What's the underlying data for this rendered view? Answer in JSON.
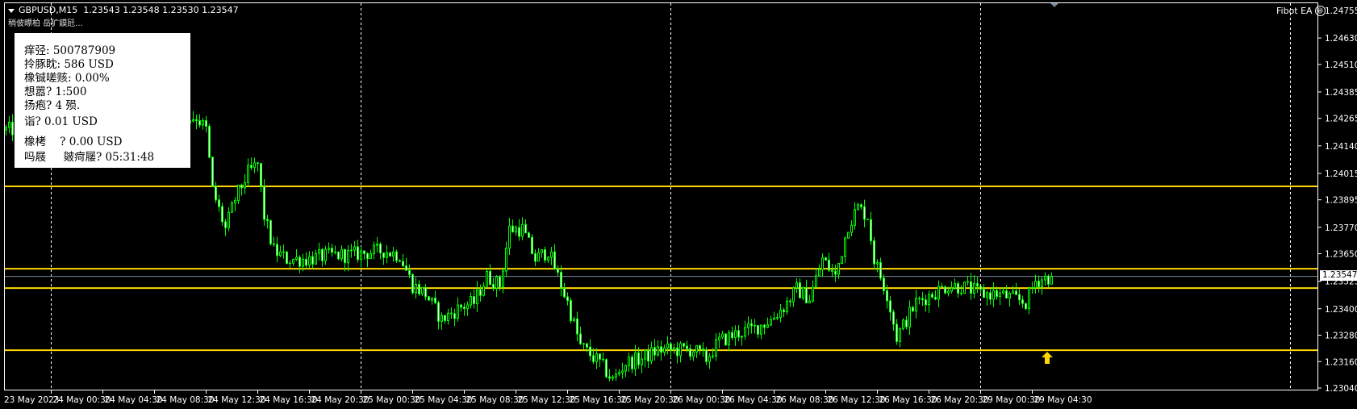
{
  "header": {
    "symbol": "GBPUSD,M15",
    "ohlc": "1.23543 1.23548 1.23530 1.23547",
    "subtitle": "稍佊瞟柏 岳犷鏌瓩..."
  },
  "info_panel": {
    "lines": [
      "痒弪: 500787909",
      "拎豚眈: 586 USD",
      "橡铖嗟赅: 0.00%",
      "想嚣? 1:500",
      "扬疱? 4 殒.",
      "诣? 0.01 USD",
      "橡栲    ? 0.00 USD",
      "吗屐     皴疴屦? 05:31:48"
    ]
  },
  "ea_label": "Fibot EA",
  "ea_icon": "smiley-icon",
  "current_price_label": "1.23547",
  "colors": {
    "candle": "#00ff00",
    "level": "#ffd700",
    "grid": "#ffffff",
    "price_line": "#778899",
    "arrow": "#ffd700"
  },
  "chart_data": {
    "type": "candlestick",
    "symbol": "GBPUSD",
    "timeframe": "M15",
    "ylim": [
      1.2304,
      1.24755
    ],
    "y_ticks": [
      "1.24755",
      "1.24630",
      "1.24510",
      "1.24385",
      "1.24265",
      "1.24140",
      "1.24015",
      "1.23895",
      "1.23770",
      "1.23650",
      "1.23525",
      "1.23400",
      "1.23280",
      "1.23160",
      "1.23040"
    ],
    "x_ticks": [
      "23 May 2023",
      "24 May 00:30",
      "24 May 04:30",
      "24 May 08:30",
      "24 May 12:30",
      "24 May 16:30",
      "24 May 20:30",
      "25 May 00:30",
      "25 May 04:30",
      "25 May 08:30",
      "25 May 12:30",
      "25 May 16:30",
      "25 May 20:30",
      "26 May 00:30",
      "26 May 04:30",
      "26 May 08:30",
      "26 May 12:30",
      "26 May 16:30",
      "26 May 20:30",
      "29 May 00:30",
      "29 May 04:30"
    ],
    "bars_per_tick": 16,
    "day_separators_bar": [
      14,
      110,
      206,
      302,
      398
    ],
    "horizontal_levels": [
      1.23956,
      1.23582,
      1.23494,
      1.23212
    ],
    "current_price": 1.23547,
    "bar_count": 325,
    "volatility": 0.0005,
    "close_path": [
      [
        0,
        1.24213
      ],
      [
        3,
        1.24213
      ],
      [
        52,
        1.24253
      ],
      [
        59,
        1.24272
      ],
      [
        62,
        1.24213
      ],
      [
        64,
        1.23939
      ],
      [
        68,
        1.23762
      ],
      [
        71,
        1.23899
      ],
      [
        75,
        1.24017
      ],
      [
        78,
        1.24056
      ],
      [
        80,
        1.23821
      ],
      [
        83,
        1.23664
      ],
      [
        87,
        1.23625
      ],
      [
        93,
        1.23625
      ],
      [
        101,
        1.23644
      ],
      [
        106,
        1.23644
      ],
      [
        117,
        1.23664
      ],
      [
        122,
        1.23644
      ],
      [
        126,
        1.23507
      ],
      [
        130,
        1.23468
      ],
      [
        135,
        1.2335
      ],
      [
        141,
        1.23409
      ],
      [
        145,
        1.23428
      ],
      [
        149,
        1.23546
      ],
      [
        153,
        1.23507
      ],
      [
        156,
        1.23762
      ],
      [
        160,
        1.23762
      ],
      [
        164,
        1.23625
      ],
      [
        168,
        1.23664
      ],
      [
        172,
        1.23507
      ],
      [
        174,
        1.23428
      ],
      [
        178,
        1.23232
      ],
      [
        184,
        1.23154
      ],
      [
        188,
        1.23075
      ],
      [
        192,
        1.23154
      ],
      [
        197,
        1.23173
      ],
      [
        202,
        1.23213
      ],
      [
        208,
        1.23213
      ],
      [
        213,
        1.23213
      ],
      [
        217,
        1.23173
      ],
      [
        221,
        1.23252
      ],
      [
        227,
        1.23291
      ],
      [
        232,
        1.23311
      ],
      [
        237,
        1.2335
      ],
      [
        241,
        1.23409
      ],
      [
        245,
        1.23487
      ],
      [
        249,
        1.23448
      ],
      [
        253,
        1.23625
      ],
      [
        257,
        1.23546
      ],
      [
        261,
        1.23782
      ],
      [
        264,
        1.2386
      ],
      [
        267,
        1.23821
      ],
      [
        269,
        1.23625
      ],
      [
        273,
        1.23468
      ],
      [
        276,
        1.23272
      ],
      [
        279,
        1.2335
      ],
      [
        282,
        1.23428
      ],
      [
        287,
        1.23468
      ],
      [
        292,
        1.23507
      ],
      [
        298,
        1.23495
      ],
      [
        302,
        1.23468
      ],
      [
        307,
        1.23468
      ],
      [
        312,
        1.23448
      ],
      [
        316,
        1.23428
      ],
      [
        319,
        1.23527
      ],
      [
        324,
        1.23547
      ]
    ],
    "signal_arrow": {
      "direction": "up",
      "bar": 324
    }
  }
}
